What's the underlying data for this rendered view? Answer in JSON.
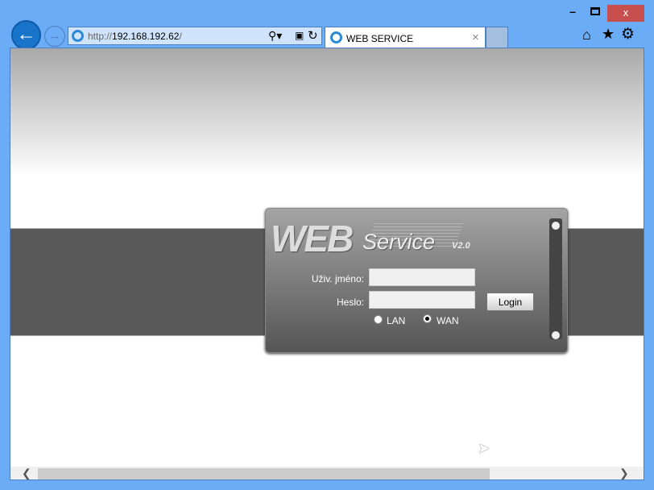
{
  "window": {
    "minimize": "–",
    "maximize": "☐",
    "close": "x"
  },
  "browser": {
    "url_prefix": "http://",
    "url_host": "192.168.192.62",
    "url_suffix": "/",
    "tab_title": "WEB SERVICE",
    "tab_close": "×"
  },
  "logo": {
    "web": "WEB",
    "service": "Service",
    "version": "V2.0"
  },
  "form": {
    "username_label": "Uživ. jméno:",
    "password_label": "Heslo:",
    "username_value": "",
    "password_value": "",
    "login_label": "Login",
    "lan_label": "LAN",
    "wan_label": "WAN",
    "selected_mode": "WAN"
  }
}
